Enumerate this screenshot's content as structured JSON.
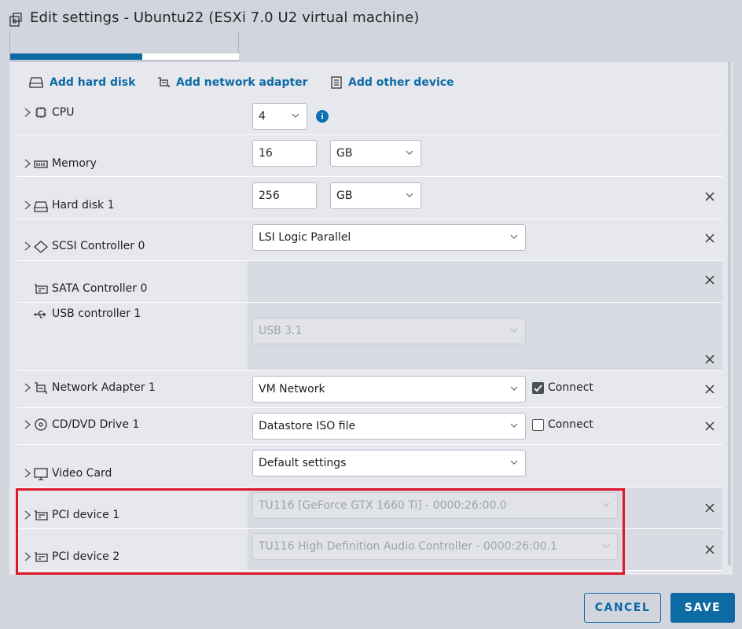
{
  "window": {
    "title": "Edit settings - Ubuntu22 (ESXi 7.0 U2 virtual machine)"
  },
  "toolbar": {
    "add_hard_disk": "Add hard disk",
    "add_network_adapter": "Add network adapter",
    "add_other_device": "Add other device"
  },
  "cpu": {
    "label": "CPU",
    "value": "4"
  },
  "memory": {
    "label": "Memory",
    "value": "16",
    "unit": "GB"
  },
  "hard_disk": {
    "label": "Hard disk 1",
    "value": "256",
    "unit": "GB"
  },
  "scsi": {
    "label": "SCSI Controller 0",
    "value": "LSI Logic Parallel"
  },
  "sata": {
    "label": "SATA Controller 0"
  },
  "usb": {
    "label": "USB controller 1",
    "value": "USB 3.1"
  },
  "network": {
    "label": "Network Adapter 1",
    "value": "VM Network",
    "connect_label": "Connect",
    "connected": true
  },
  "cdrom": {
    "label": "CD/DVD Drive 1",
    "value": "Datastore ISO file",
    "connect_label": "Connect",
    "connected": false
  },
  "video": {
    "label": "Video Card",
    "value": "Default settings"
  },
  "pci1": {
    "label": "PCI device 1",
    "value": "TU116 [GeForce GTX 1660 Ti] - 0000:26:00.0"
  },
  "pci2": {
    "label": "PCI device 2",
    "value": "TU116 High Definition Audio Controller - 0000:26:00.1"
  },
  "info_glyph": "i",
  "footer": {
    "cancel": "CANCEL",
    "save": "SAVE"
  },
  "colors": {
    "accent": "#0d6aa3",
    "highlight": "#e0172a"
  }
}
